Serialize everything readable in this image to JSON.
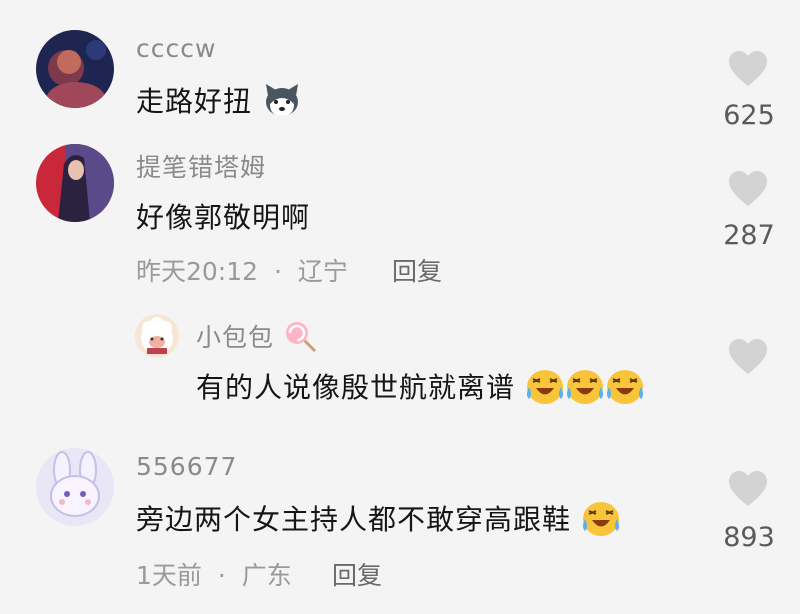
{
  "comments": [
    {
      "username": "ccccw",
      "text": "走路好扭",
      "emoji": "husky-dog-emoji",
      "likes": "625"
    },
    {
      "username": "提笔错塔姆",
      "text": "好像郭敬明啊",
      "time": "昨天20:12",
      "separator": "·",
      "location": "辽宁",
      "reply_label": "回复",
      "likes": "287"
    },
    {
      "username": "小包包",
      "username_emoji": "lollipop-emoji",
      "text": "有的人说像殷世航就离谱",
      "emoji": "laughing-crying-emoji x3",
      "is_reply": true
    },
    {
      "username": "556677",
      "text": "旁边两个女主持人都不敢穿高跟鞋",
      "emoji": "laughing-crying-emoji",
      "time": "1天前",
      "separator": "·",
      "location": "广东",
      "reply_label": "回复",
      "likes": "893"
    }
  ],
  "colors": {
    "background": "#f4f4f4",
    "username": "#8a8a8a",
    "text": "#161616",
    "meta": "#9a9a9a",
    "heart": "#d3d3d3"
  }
}
